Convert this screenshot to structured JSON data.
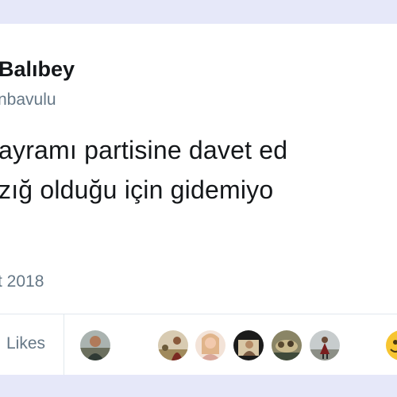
{
  "tweet": {
    "author_name": "Balıbey",
    "author_handle": "nbavulu",
    "text_line_1": "ayramı partisine davet ed",
    "text_line_2": "zığ olduğu için gidemiyo",
    "date": "t 2018"
  },
  "stats": {
    "likes_label": "Likes",
    "liker_avatars": [
      {
        "icon": "person-outdoor-avatar"
      },
      {
        "icon": "person-field-avatar"
      },
      {
        "icon": "person-portrait-avatar"
      },
      {
        "icon": "person-dark-avatar"
      },
      {
        "icon": "group-photo-avatar"
      },
      {
        "icon": "person-landscape-avatar"
      },
      {
        "icon": "emoji-avatar"
      }
    ]
  },
  "colors": {
    "background": "#e6e8f9",
    "card": "#ffffff",
    "text_primary": "#14171a",
    "text_secondary": "#657786",
    "divider": "#e1e8ed"
  }
}
